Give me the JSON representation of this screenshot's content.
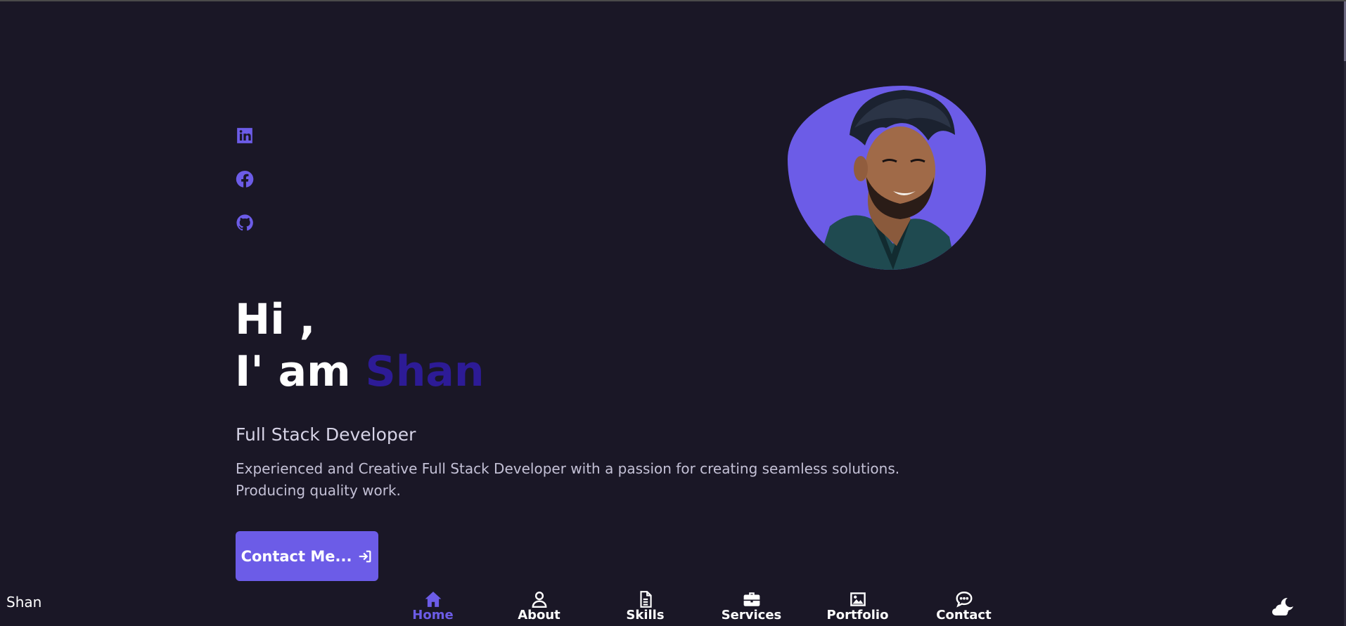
{
  "brand": "Shan",
  "socials": [
    {
      "name": "linkedin-icon"
    },
    {
      "name": "facebook-icon"
    },
    {
      "name": "github-icon"
    }
  ],
  "hero": {
    "line1": "Hi ,",
    "line2_prefix": "I' am ",
    "name": "Shan",
    "role": "Full Stack Developer",
    "description_line1": "Experienced and Creative Full Stack Developer with a passion for creating seamless solutions.",
    "description_line2": "Producing quality work.",
    "button_label": "Contact Me..."
  },
  "nav": {
    "items": [
      {
        "label": "Home",
        "icon": "home-icon",
        "active": true
      },
      {
        "label": "About",
        "icon": "user-icon",
        "active": false
      },
      {
        "label": "Skills",
        "icon": "file-icon",
        "active": false
      },
      {
        "label": "Services",
        "icon": "briefcase-icon",
        "active": false
      },
      {
        "label": "Portfolio",
        "icon": "image-icon",
        "active": false
      },
      {
        "label": "Contact",
        "icon": "chat-icon",
        "active": false
      }
    ]
  },
  "colors": {
    "background": "#1a1726",
    "accent": "#6c5ce7",
    "name_highlight": "#2d1b96"
  }
}
